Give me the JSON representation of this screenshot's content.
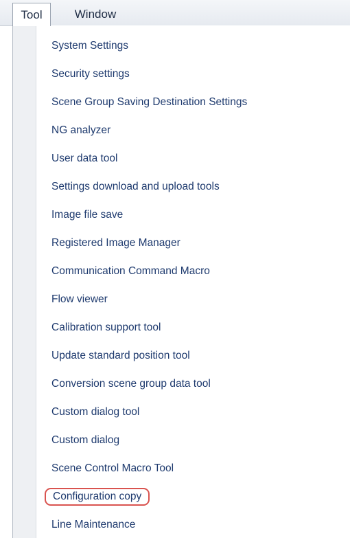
{
  "menubar": {
    "tabs": [
      {
        "label": "Tool"
      },
      {
        "label": "Window"
      }
    ]
  },
  "tool_menu": {
    "items": [
      {
        "label": "System Settings"
      },
      {
        "label": "Security settings"
      },
      {
        "label": "Scene Group Saving Destination Settings"
      },
      {
        "label": "NG analyzer"
      },
      {
        "label": "User data tool"
      },
      {
        "label": "Settings download and upload tools"
      },
      {
        "label": "Image file save"
      },
      {
        "label": "Registered Image Manager"
      },
      {
        "label": "Communication Command Macro"
      },
      {
        "label": "Flow viewer"
      },
      {
        "label": "Calibration support tool"
      },
      {
        "label": "Update standard position tool"
      },
      {
        "label": "Conversion scene group data tool"
      },
      {
        "label": "Custom dialog tool"
      },
      {
        "label": "Custom dialog"
      },
      {
        "label": "Scene Control Macro Tool"
      },
      {
        "label": "Configuration copy",
        "highlighted": true,
        "highlight_color": "#d9534f"
      },
      {
        "label": "Line Maintenance"
      }
    ]
  }
}
